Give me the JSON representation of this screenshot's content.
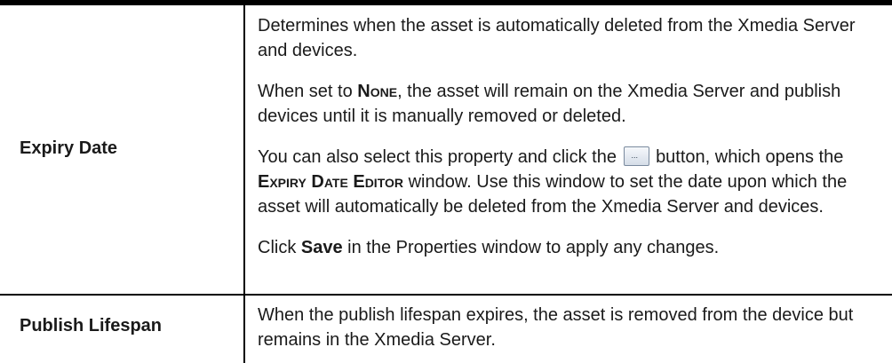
{
  "rows": [
    {
      "label": "Expiry Date",
      "p1": "Determines when the asset is automatically deleted from the Xmedia Server and devices.",
      "p2_pre": "When set to ",
      "p2_kw": "None",
      "p2_post": ", the asset will remain on the Xmedia Server and publish devices until it is manually removed or deleted.",
      "p3_pre": "You can also select this property and click the",
      "p3_mid": "button, which opens the",
      "p3_kw": "Expiry Date Editor",
      "p3_post": "window. Use this window to set the date upon which the asset will automatically be deleted from the Xmedia Server and devices.",
      "p4_pre": "Click ",
      "p4_kw": "Save",
      "p4_post": " in the Properties window to apply any changes."
    },
    {
      "label": "Publish Lifespan",
      "p1": "When the publish lifespan expires, the asset is removed from the device but remains in the Xmedia Server."
    }
  ]
}
